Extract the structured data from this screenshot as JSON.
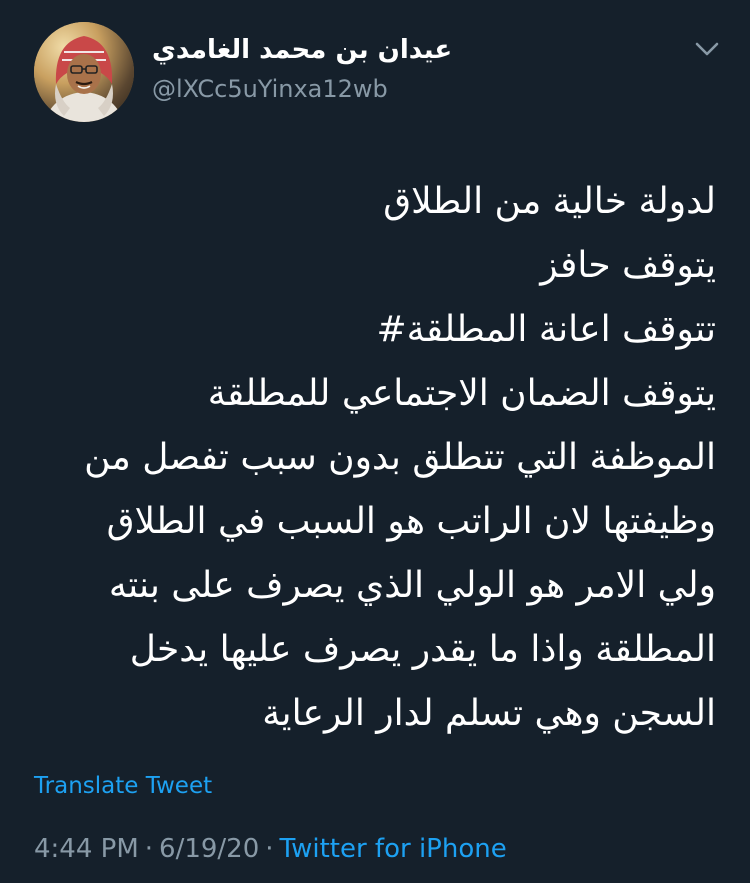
{
  "user": {
    "display_name": "عيدان بن محمد الغامدي",
    "handle": "@lXCc5uYinxa12wb"
  },
  "tweet": {
    "lines": [
      "لدولة خالية من الطلاق",
      "يتوقف حافز",
      "تتوقف اعانة المطلقة#",
      "يتوقف الضمان الاجتماعي للمطلقة",
      "الموظفة التي تتطلق بدون سبب تفصل من",
      "وظيفتها لان الراتب هو السبب في الطلاق",
      "ولي الامر هو الولي الذي يصرف على بنته",
      "المطلقة واذا ما يقدر يصرف عليها يدخل",
      "السجن وهي تسلم لدار الرعاية"
    ],
    "translate_label": "Translate Tweet",
    "time": "4:44 PM",
    "date": "6/19/20",
    "separator": "·",
    "source": "Twitter for iPhone"
  },
  "icons": {
    "menu": "chevron-down-icon",
    "avatar": "profile-avatar"
  },
  "colors": {
    "background": "#15202b",
    "text": "#ffffff",
    "secondary": "#8899a6",
    "accent": "#1da1f2"
  }
}
